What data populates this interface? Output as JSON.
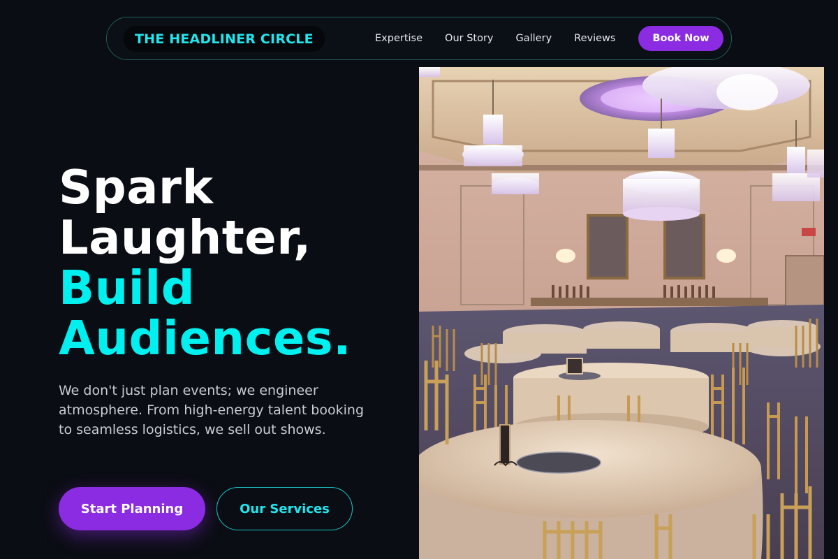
{
  "nav": {
    "logo": "THE HEADLINER CIRCLE",
    "links": [
      "Expertise",
      "Our Story",
      "Gallery",
      "Reviews"
    ],
    "cta": "Book Now"
  },
  "hero": {
    "title_line1": "Spark",
    "title_line2": "Laughter,",
    "title_line3": "Build",
    "title_line4": "Audiences.",
    "description": "We don't just plan events; we engineer atmosphere. From high-energy talent booking to seamless logistics, we sell out shows.",
    "primary_button": "Start Planning",
    "secondary_button": "Our Services",
    "image_icon": "ballroom-photo"
  },
  "colors": {
    "background": "#0b0d14",
    "accent_cyan": "#00f0f0",
    "accent_purple": "#8b2be2",
    "text_muted": "#c9ccd4"
  }
}
